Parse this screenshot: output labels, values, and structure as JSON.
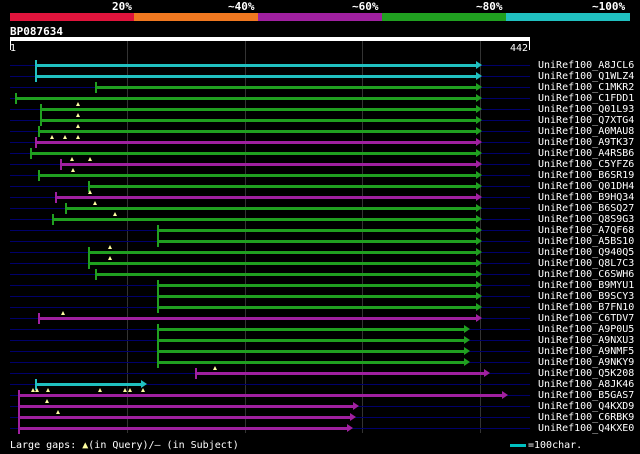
{
  "legend": {
    "colors": [
      "#e0143c",
      "#f07820",
      "#a020a0",
      "#20a020",
      "#20c0c0"
    ],
    "labels": [
      "20%",
      "~40%",
      "~60%",
      "~80%",
      "~100%"
    ]
  },
  "query": {
    "id": "BP087634",
    "start": "1",
    "end": "442"
  },
  "hits": [
    {
      "name": "UniRef100_A8JCL6",
      "s": 35,
      "e": 476,
      "color": "#20c0c0",
      "gaps": []
    },
    {
      "name": "UniRef100_Q1WLZ4",
      "s": 35,
      "e": 476,
      "color": "#20c0c0",
      "gaps": []
    },
    {
      "name": "UniRef100_C1MKR2",
      "s": 95,
      "e": 476,
      "color": "#20a020",
      "gaps": []
    },
    {
      "name": "UniRef100_C1FDD1",
      "s": 15,
      "e": 476,
      "color": "#20a020",
      "gaps": []
    },
    {
      "name": "UniRef100_Q01L93",
      "s": 40,
      "e": 476,
      "color": "#20a020",
      "gaps": [
        78
      ]
    },
    {
      "name": "UniRef100_Q7XTG4",
      "s": 40,
      "e": 476,
      "color": "#20a020",
      "gaps": [
        78
      ]
    },
    {
      "name": "UniRef100_A0MAU8",
      "s": 38,
      "e": 476,
      "color": "#20a020",
      "gaps": [
        78
      ]
    },
    {
      "name": "UniRef100_A9TK37",
      "s": 35,
      "e": 476,
      "color": "#a020a0",
      "gaps": [
        52,
        65,
        78
      ]
    },
    {
      "name": "UniRef100_A4RSB6",
      "s": 30,
      "e": 476,
      "color": "#20a020",
      "gaps": []
    },
    {
      "name": "UniRef100_C5YFZ6",
      "s": 60,
      "e": 476,
      "color": "#a020a0",
      "gaps": [
        72,
        90
      ]
    },
    {
      "name": "UniRef100_B6SR19",
      "s": 38,
      "e": 476,
      "color": "#20a020",
      "gaps": [
        73
      ]
    },
    {
      "name": "UniRef100_Q01DH4",
      "s": 88,
      "e": 476,
      "color": "#20a020",
      "gaps": []
    },
    {
      "name": "UniRef100_B9HQ34",
      "s": 55,
      "e": 476,
      "color": "#a020a0",
      "gaps": [
        90
      ]
    },
    {
      "name": "UniRef100_B6SQ27",
      "s": 65,
      "e": 476,
      "color": "#20a020",
      "gaps": [
        95
      ]
    },
    {
      "name": "UniRef100_Q8S9G3",
      "s": 52,
      "e": 476,
      "color": "#20a020",
      "gaps": [
        115
      ]
    },
    {
      "name": "UniRef100_A7QF68",
      "s": 157,
      "e": 476,
      "color": "#20a020",
      "gaps": []
    },
    {
      "name": "UniRef100_A5BS10",
      "s": 157,
      "e": 476,
      "color": "#20a020",
      "gaps": []
    },
    {
      "name": "UniRef100_Q940Q5",
      "s": 88,
      "e": 476,
      "color": "#20a020",
      "gaps": [
        110
      ]
    },
    {
      "name": "UniRef100_Q8L7C3",
      "s": 88,
      "e": 476,
      "color": "#20a020",
      "gaps": [
        110
      ]
    },
    {
      "name": "UniRef100_C6SWH6",
      "s": 95,
      "e": 476,
      "color": "#20a020",
      "gaps": []
    },
    {
      "name": "UniRef100_B9MYU1",
      "s": 157,
      "e": 476,
      "color": "#20a020",
      "gaps": []
    },
    {
      "name": "UniRef100_B9SCY3",
      "s": 157,
      "e": 476,
      "color": "#20a020",
      "gaps": []
    },
    {
      "name": "UniRef100_B7FN10",
      "s": 157,
      "e": 476,
      "color": "#20a020",
      "gaps": []
    },
    {
      "name": "UniRef100_C6TDV7",
      "s": 38,
      "e": 476,
      "color": "#a020a0",
      "gaps": [
        63
      ]
    },
    {
      "name": "UniRef100_A9P0U5",
      "s": 157,
      "e": 464,
      "color": "#20a020",
      "gaps": []
    },
    {
      "name": "UniRef100_A9NXU3",
      "s": 157,
      "e": 464,
      "color": "#20a020",
      "gaps": []
    },
    {
      "name": "UniRef100_A9NMF5",
      "s": 157,
      "e": 464,
      "color": "#20a020",
      "gaps": []
    },
    {
      "name": "UniRef100_A9NKY9",
      "s": 157,
      "e": 464,
      "color": "#20a020",
      "gaps": []
    },
    {
      "name": "UniRef100_Q5K208",
      "s": 195,
      "e": 484,
      "color": "#a020a0",
      "gaps": [
        215
      ]
    },
    {
      "name": "UniRef100_A8JK46",
      "s": 35,
      "e": 141,
      "color": "#20c0c0",
      "gaps": []
    },
    {
      "name": "UniRef100_B5GAS7",
      "s": 18,
      "e": 502,
      "color": "#a020a0",
      "gaps": [
        33,
        37,
        48,
        100,
        125,
        130,
        143
      ]
    },
    {
      "name": "UniRef100_Q4KXD9",
      "s": 18,
      "e": 353,
      "color": "#a020a0",
      "gaps": [
        47
      ]
    },
    {
      "name": "UniRef100_C6RBK9",
      "s": 18,
      "e": 350,
      "color": "#a020a0",
      "gaps": [
        58
      ]
    },
    {
      "name": "UniRef100_Q4KXE0",
      "s": 18,
      "e": 347,
      "color": "#a020a0",
      "gaps": []
    }
  ],
  "footer": {
    "prefix": "Large gaps: ",
    "query_mark": "▲",
    "query_text": "(in Query)/",
    "subject_text": "– (in Subject)"
  },
  "scale": {
    "label": "=100char."
  }
}
